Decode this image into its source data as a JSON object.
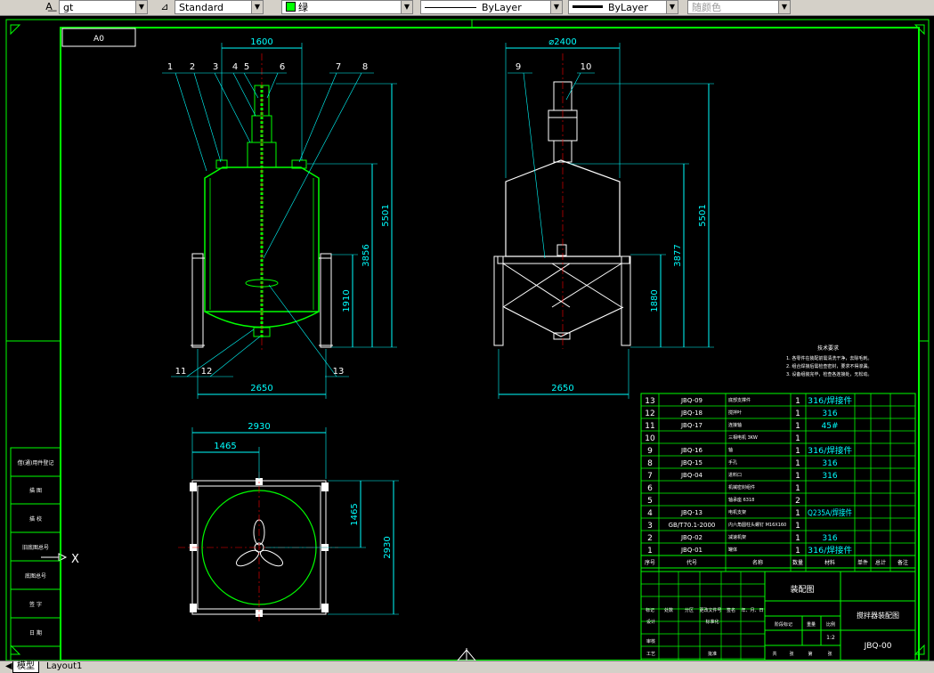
{
  "toolbar": {
    "textstyle_value": "gt",
    "dimstyle_value": "Standard",
    "color_value": "绿",
    "linetype_value": "ByLayer",
    "lineweight_value": "ByLayer",
    "plotstyle_value": "随颜色"
  },
  "drawing": {
    "sheet_size": "A0",
    "colors": {
      "frame": "#00ff00",
      "dim": "#00ffff",
      "part": "#00ff00",
      "leader": "#00ffff",
      "text": "#ffffff"
    },
    "front_view": {
      "top_width": "1600",
      "bottom_width": "2650",
      "dims_right": [
        "5501",
        "3856",
        "1910"
      ],
      "balloons_top": [
        "1",
        "2",
        "3",
        "4",
        "5",
        "6",
        "7",
        "8"
      ],
      "balloons_bottom": [
        "11",
        "12",
        "13"
      ]
    },
    "side_view": {
      "diameter": "⌀2400",
      "bottom_width": "2650",
      "dims_right": [
        "5501",
        "3877",
        "1880"
      ],
      "balloons_top": [
        "9",
        "10"
      ]
    },
    "top_view": {
      "width": "2930",
      "half_width": "1465",
      "height": "2930",
      "half_height": "1465"
    },
    "tech_notes": {
      "title": "技术要求",
      "lines": [
        "1. 各零件在装配前需清洗干净，去除毛刺。",
        "2. 组合焊接后需检查密封，要求不得渗漏。",
        "3. 设备组装完毕，检查各连接处，无松动。"
      ]
    },
    "left_table": [
      "借(通)用件登记",
      "描 图",
      "描 校",
      "旧底图总号",
      "底图总号",
      "签 字",
      "日 期"
    ],
    "bom_rows": [
      {
        "no": "13",
        "code": "JBQ-09",
        "name": "底部支撑件",
        "qty": "1",
        "mat": "316/焊接件"
      },
      {
        "no": "12",
        "code": "JBQ-18",
        "name": "搅拌叶",
        "qty": "1",
        "mat": "316"
      },
      {
        "no": "11",
        "code": "JBQ-17",
        "name": "连接轴",
        "qty": "1",
        "mat": "45#"
      },
      {
        "no": "10",
        "code": "",
        "name": "三相电机 3KW",
        "qty": "1",
        "mat": ""
      },
      {
        "no": "9",
        "code": "JBQ-16",
        "name": "轴",
        "qty": "1",
        "mat": "316/焊接件"
      },
      {
        "no": "8",
        "code": "JBQ-15",
        "name": "手孔",
        "qty": "1",
        "mat": "316"
      },
      {
        "no": "7",
        "code": "JBQ-04",
        "name": "进料口",
        "qty": "1",
        "mat": "316"
      },
      {
        "no": "6",
        "code": "",
        "name": "机械密封组件",
        "qty": "1",
        "mat": ""
      },
      {
        "no": "5",
        "code": "",
        "name": "轴承座 6318",
        "qty": "2",
        "mat": ""
      },
      {
        "no": "4",
        "code": "JBQ-13",
        "name": "电机支架",
        "qty": "1",
        "mat": "Q235A/焊接件"
      },
      {
        "no": "3",
        "code": "GB/T70.1-2000",
        "name": "内六角圆柱头螺钉 M16X160",
        "qty": "1",
        "mat": ""
      },
      {
        "no": "2",
        "code": "JBQ-02",
        "name": "减速机架",
        "qty": "1",
        "mat": "316"
      },
      {
        "no": "1",
        "code": "JBQ-01",
        "name": "罐体",
        "qty": "1",
        "mat": "316/焊接件"
      }
    ],
    "bom_header": [
      "序号",
      "代号",
      "名称",
      "数量",
      "材料",
      "单件",
      "总计",
      "备注"
    ],
    "title_block": {
      "drawing_type": "装配图",
      "product_name": "搅拌器装配图",
      "drawing_no": "JBQ-00",
      "row_labels": [
        "标记",
        "处数",
        "分区",
        "更改文件号",
        "签名",
        "年、月、日"
      ],
      "side_labels": [
        "设计",
        "审核",
        "工艺"
      ],
      "std_label": "标准化",
      "approve_label": "批准",
      "stage_labels": [
        "阶段标记",
        "重量",
        "比例"
      ],
      "scale": "1:2",
      "sheet_labels": [
        "共",
        "张",
        "第",
        "张"
      ]
    },
    "ucs_x": "X"
  },
  "layout_tabs": [
    "模型",
    "Layout1"
  ]
}
